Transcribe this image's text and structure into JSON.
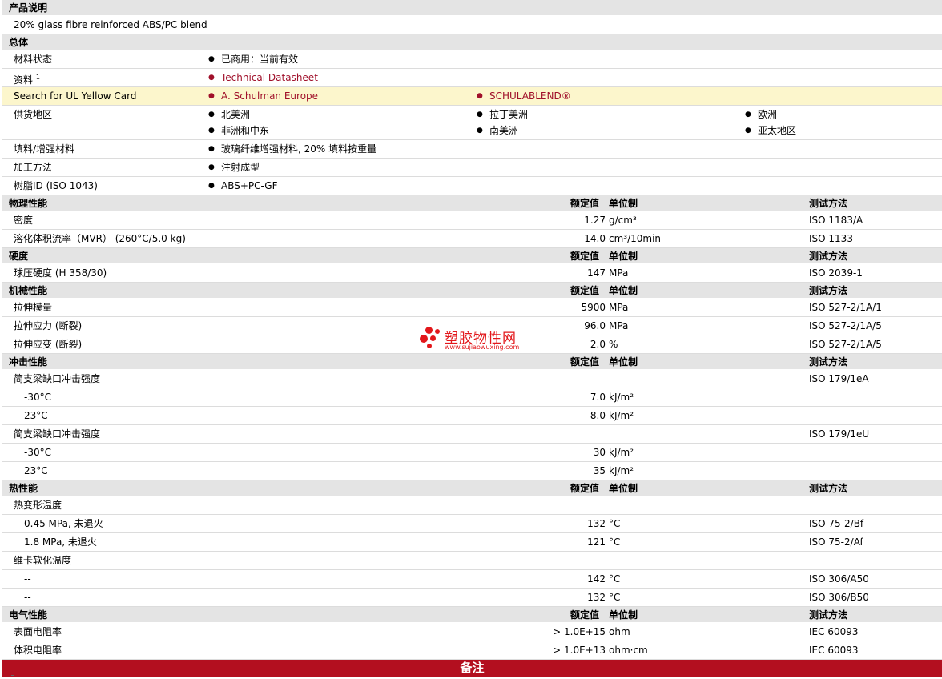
{
  "sections": {
    "desc_title": "产品说明",
    "desc_text": "20% glass fibre reinforced ABS/PC blend",
    "general_title": "总体",
    "physical_title": "物理性能",
    "hardness_title": "硬度",
    "mechanical_title": "机械性能",
    "impact_title": "冲击性能",
    "thermal_title": "热性能",
    "electrical_title": "电气性能",
    "notes_title": "备注"
  },
  "headers": {
    "nominal": "额定值",
    "unit": "单位制",
    "method": "测试方法"
  },
  "general": {
    "status_label": "材料状态",
    "status_value": "已商用：当前有效",
    "docs_label": "资料",
    "docs_sup": "1",
    "docs_value": "Technical Datasheet",
    "ul_label": "Search for UL Yellow Card",
    "ul_v1": "A. Schulman Europe",
    "ul_v2": "SCHULABLEND®",
    "region_label": "供货地区",
    "regions": [
      "北美洲",
      "拉丁美洲",
      "欧洲",
      "非洲和中东",
      "南美洲",
      "亚太地区"
    ],
    "filler_label": "填料/增强材料",
    "filler_value": "玻璃纤维增强材料, 20% 填料按重量",
    "process_label": "加工方法",
    "process_value": "注射成型",
    "resin_label": "树脂ID (ISO 1043)",
    "resin_value": "ABS+PC-GF"
  },
  "physical": [
    {
      "label": "密度",
      "value": "1.27",
      "unit": "g/cm³",
      "method": "ISO 1183/A"
    },
    {
      "label": "溶化体积流率（MVR） (260°C/5.0 kg)",
      "value": "14.0",
      "unit": "cm³/10min",
      "method": "ISO 1133"
    }
  ],
  "hardness": [
    {
      "label": "球压硬度 (H 358/30)",
      "value": "147",
      "unit": "MPa",
      "method": "ISO 2039-1"
    }
  ],
  "mechanical": [
    {
      "label": "拉伸模量",
      "value": "5900",
      "unit": "MPa",
      "method": "ISO 527-2/1A/1"
    },
    {
      "label": "拉伸应力 (断裂)",
      "value": "96.0",
      "unit": "MPa",
      "method": "ISO 527-2/1A/5"
    },
    {
      "label": "拉伸应变 (断裂)",
      "value": "2.0",
      "unit": "%",
      "method": "ISO 527-2/1A/5"
    }
  ],
  "impact": {
    "notched_label": "简支梁缺口冲击强度",
    "notched_method": "ISO 179/1eA",
    "notched_rows": [
      {
        "label": "-30°C",
        "value": "7.0",
        "unit": "kJ/m²"
      },
      {
        "label": "23°C",
        "value": "8.0",
        "unit": "kJ/m²"
      }
    ],
    "unnotched_label": "简支梁缺口冲击强度",
    "unnotched_method": "ISO 179/1eU",
    "unnotched_rows": [
      {
        "label": "-30°C",
        "value": "30",
        "unit": "kJ/m²"
      },
      {
        "label": "23°C",
        "value": "35",
        "unit": "kJ/m²"
      }
    ]
  },
  "thermal": {
    "hdt_label": "热变形温度",
    "hdt_rows": [
      {
        "label": "0.45 MPa, 未退火",
        "value": "132",
        "unit": "°C",
        "method": "ISO 75-2/Bf"
      },
      {
        "label": "1.8 MPa, 未退火",
        "value": "121",
        "unit": "°C",
        "method": "ISO 75-2/Af"
      }
    ],
    "vicat_label": "维卡软化温度",
    "vicat_rows": [
      {
        "label": "--",
        "value": "142",
        "unit": "°C",
        "method": "ISO 306/A50"
      },
      {
        "label": "--",
        "value": "132",
        "unit": "°C",
        "method": "ISO 306/B50"
      }
    ]
  },
  "electrical": [
    {
      "label": "表面电阻率",
      "value": "> 1.0E+15",
      "unit": "ohm",
      "method": "IEC 60093"
    },
    {
      "label": "体积电阻率",
      "value": "> 1.0E+13",
      "unit": "ohm·cm",
      "method": "IEC 60093"
    }
  ],
  "watermark": {
    "text": "塑胶物性网",
    "url": "www.sujiaowuxing.com",
    "color": "#e2171b"
  }
}
